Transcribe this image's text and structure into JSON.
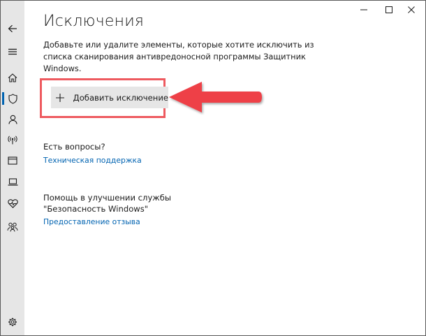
{
  "window": {
    "controls": [
      "minimize",
      "maximize",
      "close"
    ]
  },
  "sidebar": {
    "items": [
      {
        "name": "back",
        "icon": "back-arrow-icon"
      },
      {
        "name": "menu",
        "icon": "hamburger-icon"
      },
      {
        "name": "home",
        "icon": "home-icon"
      },
      {
        "name": "virus-protection",
        "icon": "shield-icon",
        "selected": true
      },
      {
        "name": "account-protection",
        "icon": "person-icon"
      },
      {
        "name": "firewall",
        "icon": "antenna-icon"
      },
      {
        "name": "app-browser-control",
        "icon": "app-window-icon"
      },
      {
        "name": "device-security",
        "icon": "laptop-icon"
      },
      {
        "name": "device-performance",
        "icon": "heart-icon"
      },
      {
        "name": "family-options",
        "icon": "family-icon"
      },
      {
        "name": "settings",
        "icon": "gear-icon"
      }
    ]
  },
  "main": {
    "title": "Исключения",
    "description": "Добавьте или удалите элементы, которые хотите исключить из списка сканирования антивредоносной программы Защитник Windows.",
    "add_button_label": "Добавить исключение",
    "questions_heading": "Есть вопросы?",
    "support_link": "Техническая поддержка",
    "improve_heading_line1": "Помощь в улучшении службы",
    "improve_heading_line2": "\"Безопасность Windows\"",
    "feedback_link": "Предоставление отзыва"
  },
  "colors": {
    "sidebar_bg": "#e6e6e6",
    "accent": "#0063b1",
    "highlight": "#ee5a5f",
    "button_bg": "#e6e6e6"
  }
}
